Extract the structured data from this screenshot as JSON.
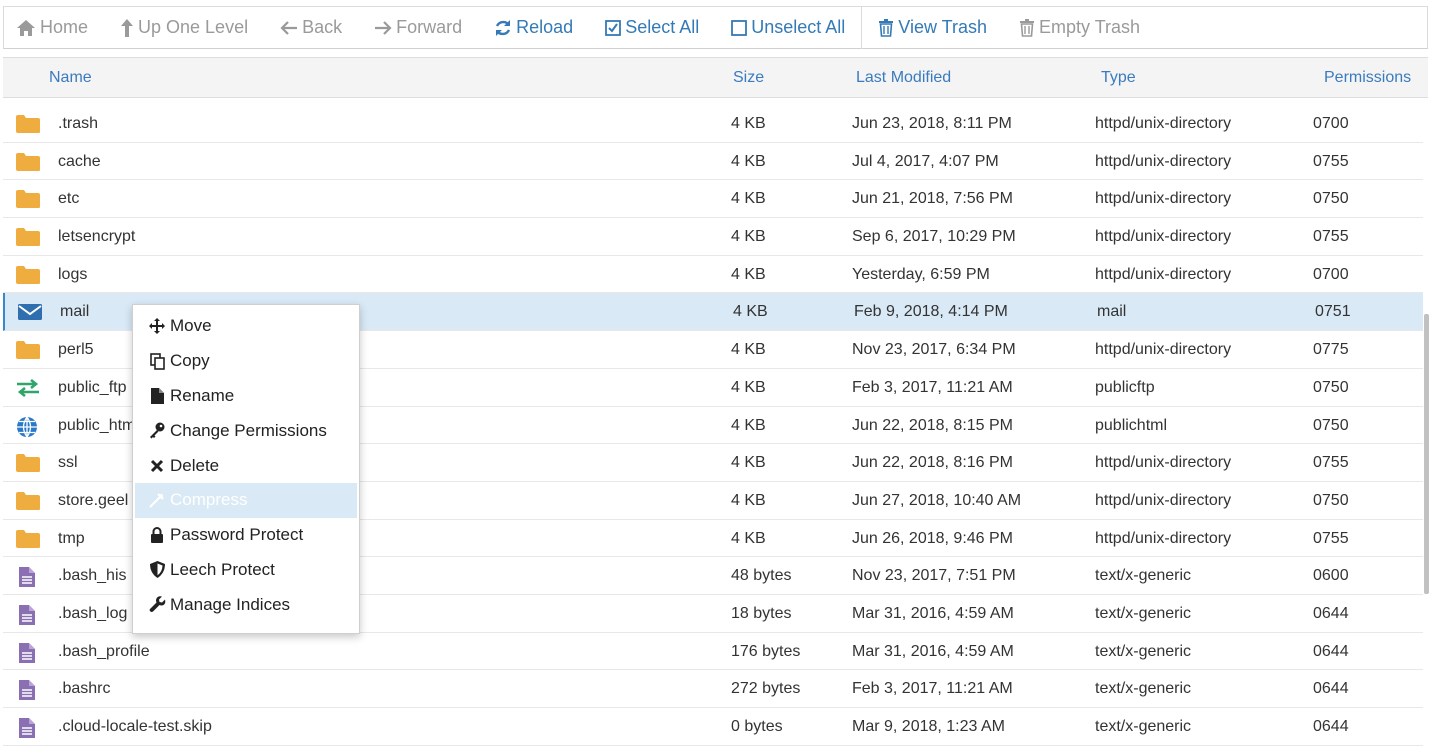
{
  "toolbar": {
    "home": "Home",
    "up_one_level": "Up One Level",
    "back": "Back",
    "forward": "Forward",
    "reload": "Reload",
    "select_all": "Select All",
    "unselect_all": "Unselect All",
    "view_trash": "View Trash",
    "empty_trash": "Empty Trash"
  },
  "table": {
    "headers": {
      "name": "Name",
      "size": "Size",
      "last_modified": "Last Modified",
      "type": "Type",
      "permissions": "Permissions"
    },
    "rows": [
      {
        "icon": "folder-icon",
        "name": ".trash",
        "size": "4 KB",
        "modified": "Jun 23, 2018, 8:11 PM",
        "type": "httpd/unix-directory",
        "perm": "0700"
      },
      {
        "icon": "folder-icon",
        "name": "cache",
        "size": "4 KB",
        "modified": "Jul 4, 2017, 4:07 PM",
        "type": "httpd/unix-directory",
        "perm": "0755"
      },
      {
        "icon": "folder-icon",
        "name": "etc",
        "size": "4 KB",
        "modified": "Jun 21, 2018, 7:56 PM",
        "type": "httpd/unix-directory",
        "perm": "0750"
      },
      {
        "icon": "folder-icon",
        "name": "letsencrypt",
        "size": "4 KB",
        "modified": "Sep 6, 2017, 10:29 PM",
        "type": "httpd/unix-directory",
        "perm": "0755"
      },
      {
        "icon": "folder-icon",
        "name": "logs",
        "size": "4 KB",
        "modified": "Yesterday, 6:59 PM",
        "type": "httpd/unix-directory",
        "perm": "0700"
      },
      {
        "icon": "mail-icon",
        "name": "mail",
        "size": "4 KB",
        "modified": "Feb 9, 2018, 4:14 PM",
        "type": "mail",
        "perm": "0751"
      },
      {
        "icon": "folder-icon",
        "name": "perl5",
        "size": "4 KB",
        "modified": "Nov 23, 2017, 6:34 PM",
        "type": "httpd/unix-directory",
        "perm": "0775"
      },
      {
        "icon": "exchange-icon",
        "name": "public_ftp",
        "size": "4 KB",
        "modified": "Feb 3, 2017, 11:21 AM",
        "type": "publicftp",
        "perm": "0750"
      },
      {
        "icon": "globe-icon",
        "name": "public_html",
        "size": "4 KB",
        "modified": "Jun 22, 2018, 8:15 PM",
        "type": "publichtml",
        "perm": "0750"
      },
      {
        "icon": "folder-icon",
        "name": "ssl",
        "size": "4 KB",
        "modified": "Jun 22, 2018, 8:16 PM",
        "type": "httpd/unix-directory",
        "perm": "0755"
      },
      {
        "icon": "folder-icon",
        "name": "store.geel",
        "size": "4 KB",
        "modified": "Jun 27, 2018, 10:40 AM",
        "type": "httpd/unix-directory",
        "perm": "0750"
      },
      {
        "icon": "folder-icon",
        "name": "tmp",
        "size": "4 KB",
        "modified": "Jun 26, 2018, 9:46 PM",
        "type": "httpd/unix-directory",
        "perm": "0755"
      },
      {
        "icon": "file-icon",
        "name": ".bash_his",
        "size": "48 bytes",
        "modified": "Nov 23, 2017, 7:51 PM",
        "type": "text/x-generic",
        "perm": "0600"
      },
      {
        "icon": "file-icon",
        "name": ".bash_log",
        "size": "18 bytes",
        "modified": "Mar 31, 2016, 4:59 AM",
        "type": "text/x-generic",
        "perm": "0644"
      },
      {
        "icon": "file-icon",
        "name": ".bash_profile",
        "size": "176 bytes",
        "modified": "Mar 31, 2016, 4:59 AM",
        "type": "text/x-generic",
        "perm": "0644"
      },
      {
        "icon": "file-icon",
        "name": ".bashrc",
        "size": "272 bytes",
        "modified": "Feb 3, 2017, 11:21 AM",
        "type": "text/x-generic",
        "perm": "0644"
      },
      {
        "icon": "file-icon",
        "name": ".cloud-locale-test.skip",
        "size": "0 bytes",
        "modified": "Mar 9, 2018, 1:23 AM",
        "type": "text/x-generic",
        "perm": "0644"
      }
    ]
  },
  "context_menu": {
    "items": [
      {
        "icon": "move-icon",
        "label": "Move"
      },
      {
        "icon": "copy-icon",
        "label": "Copy"
      },
      {
        "icon": "file-icon",
        "label": "Rename"
      },
      {
        "icon": "key-icon",
        "label": "Change Permissions"
      },
      {
        "icon": "close-icon",
        "label": "Delete"
      },
      {
        "icon": "compress-icon",
        "label": "Compress"
      },
      {
        "icon": "lock-icon",
        "label": "Password Protect"
      },
      {
        "icon": "shield-icon",
        "label": "Leech Protect"
      },
      {
        "icon": "wrench-icon",
        "label": "Manage Indices"
      }
    ]
  },
  "colors": {
    "accent": "#337ab7",
    "folder": "#f0ad3f",
    "selected_row": "#d9e9f6",
    "file_icon": "#8a6fb3",
    "mail_icon": "#2f6fb0",
    "exchange_icon": "#2fa56a",
    "globe_icon": "#2a79c8"
  }
}
